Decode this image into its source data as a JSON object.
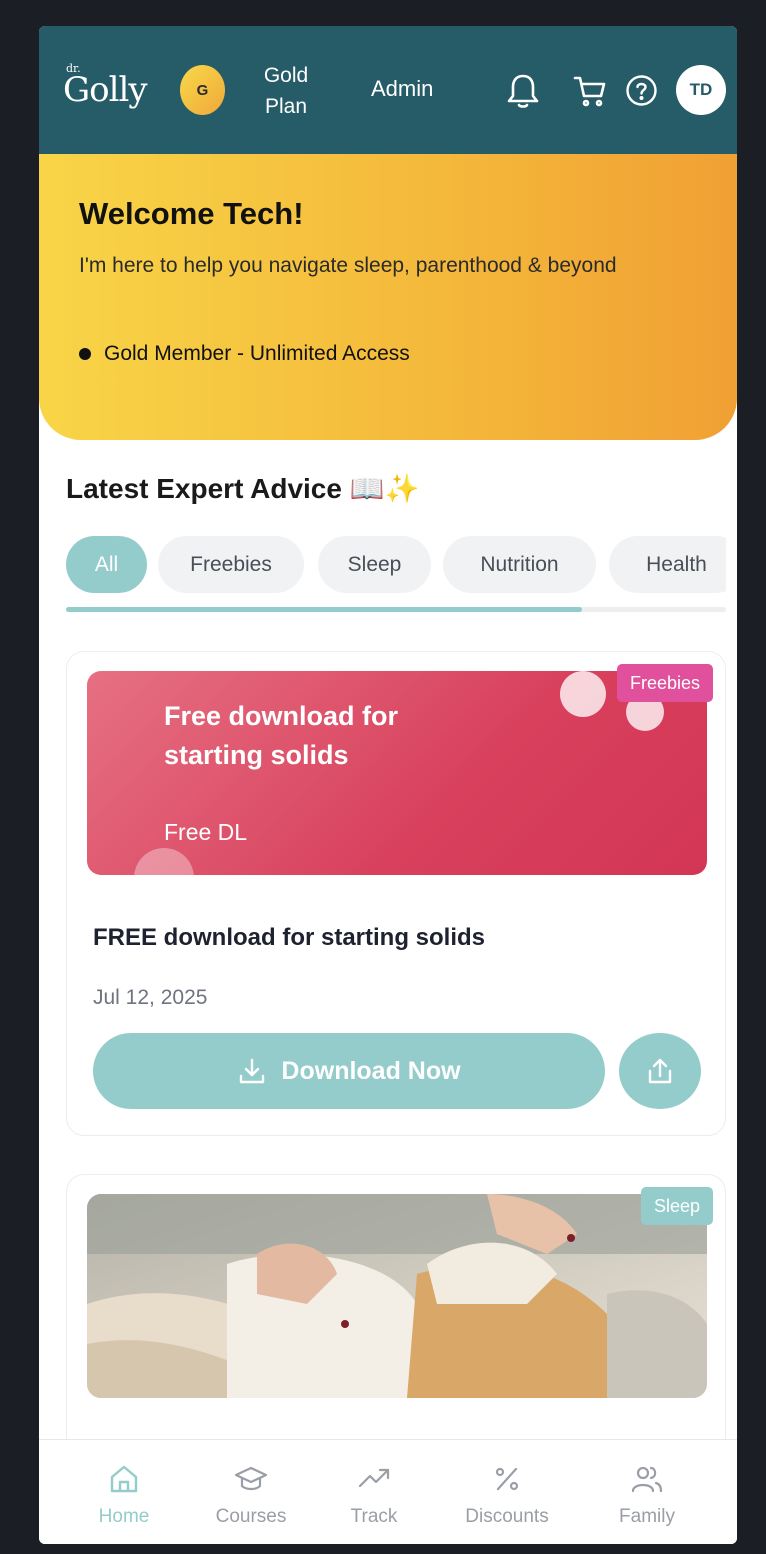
{
  "header": {
    "logo_dr": "dr.",
    "logo_word": "Golly",
    "plan_badge": "G",
    "plan_line1": "Gold",
    "plan_line2": "Plan",
    "admin_label": "Admin",
    "avatar_initials": "TD",
    "icons": [
      "bell-icon",
      "cart-icon",
      "help-icon"
    ],
    "bg_color": "#265c67"
  },
  "hero": {
    "title": "Welcome Tech!",
    "subtitle": "I'm here to help you navigate sleep, parenthood & beyond",
    "membership": "Gold Member - Unlimited Access"
  },
  "section": {
    "title": "Latest Expert Advice 📖✨"
  },
  "filters": {
    "selected": "All",
    "items": [
      "All",
      "Freebies",
      "Sleep",
      "Nutrition",
      "Health"
    ]
  },
  "cards": [
    {
      "tag": "Freebies",
      "banner_text": "Free download for starting solids",
      "banner_small": "Free DL",
      "title": "FREE download for starting solids",
      "date": "Jul 12, 2025",
      "button_label": "Download Now"
    },
    {
      "tag": "Sleep"
    }
  ],
  "bottom_nav": {
    "active": "Home",
    "items": [
      "Home",
      "Courses",
      "Track",
      "Discounts",
      "Family"
    ]
  },
  "colors": {
    "accent": "#93cccb",
    "freebies_tag": "#e0509c",
    "banner": "#d8405c"
  }
}
